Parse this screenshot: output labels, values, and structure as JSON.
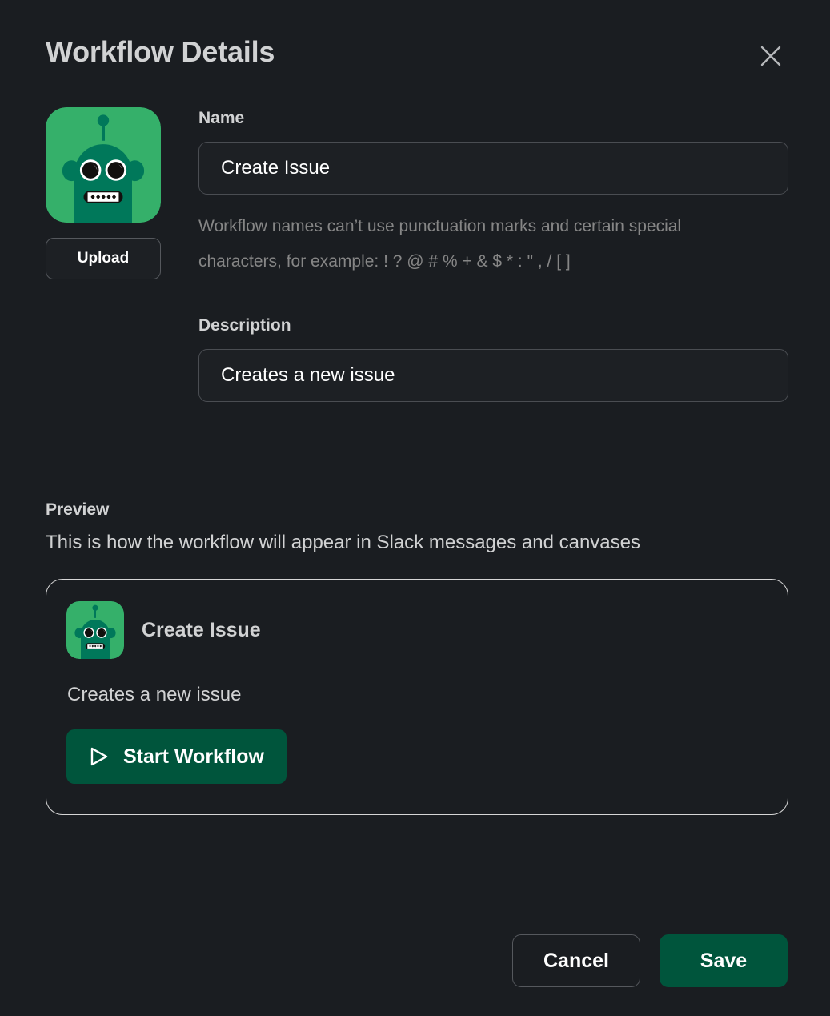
{
  "dialog": {
    "title": "Workflow Details",
    "close_icon": "close-icon"
  },
  "avatar": {
    "icon_name": "robot-avatar-icon",
    "upload_label": "Upload",
    "colors": {
      "tile_background": "#35b06a",
      "robot_body": "#00785a",
      "eye_white": "#ffffff",
      "eye_pupil": "#12100e",
      "mouth": "#ffffff"
    }
  },
  "form": {
    "name": {
      "label": "Name",
      "value": "Create Issue",
      "placeholder": "Name",
      "helper": "Workflow names can’t use punctuation marks and certain special characters, for example: ! ? @ # % + & $ * : \" , / [ ]"
    },
    "description": {
      "label": "Description",
      "value": "Creates a new issue",
      "placeholder": "Description"
    }
  },
  "preview": {
    "heading": "Preview",
    "subtext": "This is how the workflow will appear in Slack messages and canvases",
    "card": {
      "title": "Create Issue",
      "description": "Creates a new issue",
      "button_label": "Start Workflow",
      "button_icon": "play-triangle-icon",
      "button_color": "#00553c"
    }
  },
  "footer": {
    "cancel_label": "Cancel",
    "save_label": "Save",
    "save_color": "#00553c"
  },
  "theme": {
    "background": "#1a1d21",
    "text_primary": "#d1d2d3",
    "text_muted": "#868686",
    "border": "#4a4d52"
  }
}
